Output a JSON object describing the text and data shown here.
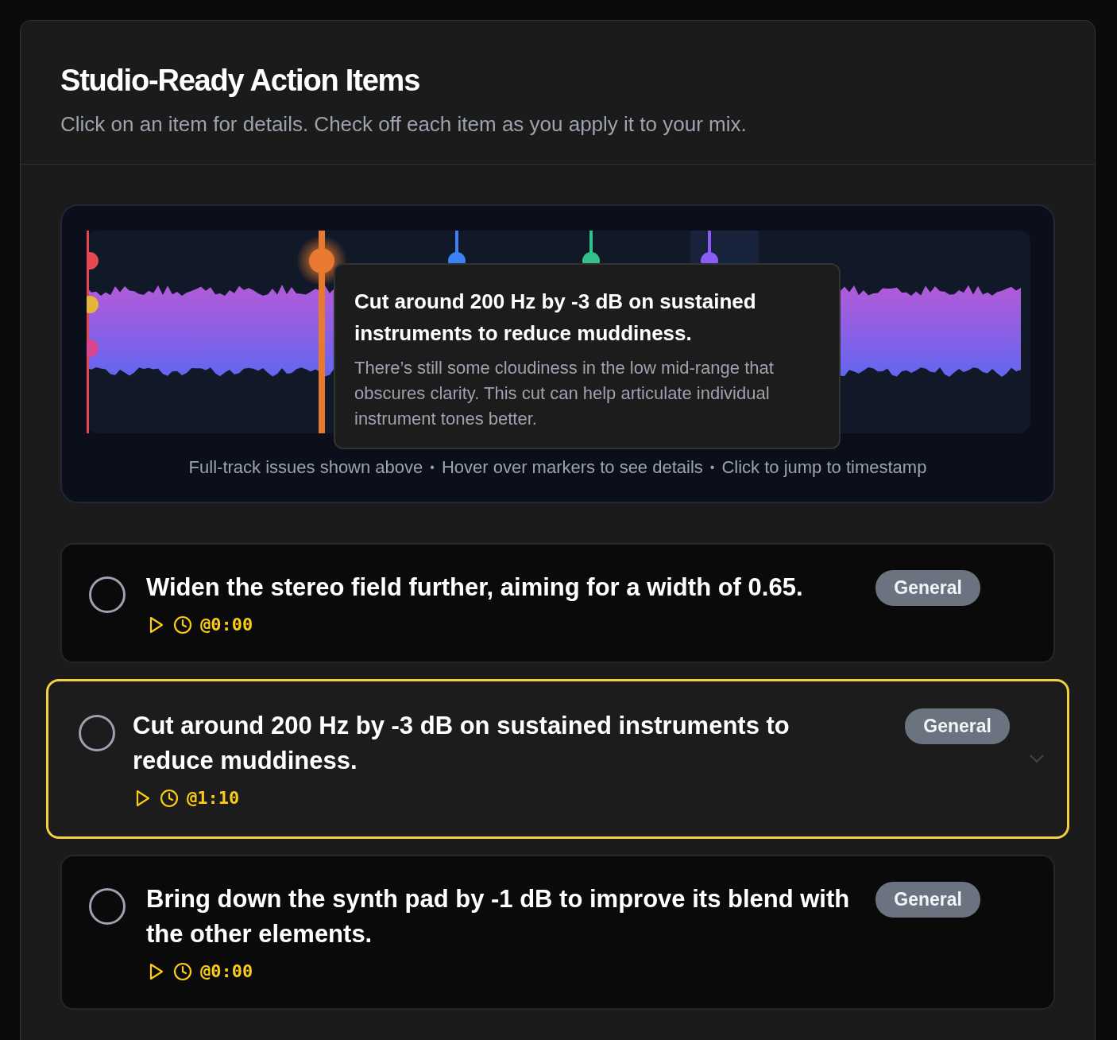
{
  "header": {
    "title": "Studio-Ready Action Items",
    "subtitle": "Click on an item for details. Check off each item as you apply it to your mix."
  },
  "timeline": {
    "edge_markers": [
      {
        "color": "#e5484d"
      },
      {
        "color": "#e5b53a"
      },
      {
        "color": "#d9468f"
      }
    ],
    "markers": [
      {
        "color": "#e8792f",
        "selected": true
      },
      {
        "color": "#3b82f6",
        "selected": false
      },
      {
        "color": "#34c08a",
        "selected": false
      },
      {
        "color": "#8b5cf6",
        "selected": false
      }
    ],
    "tooltip": {
      "title": "Cut around 200 Hz by -3 dB on sustained instruments to reduce muddiness.",
      "body": "There’s still some cloudiness in the low mid-range that obscures clarity. This cut can help articulate individual instrument tones better."
    },
    "caption": [
      "Full-track issues shown above",
      "Hover over markers to see details",
      "Click to jump to timestamp"
    ],
    "separator": "•"
  },
  "items": [
    {
      "title": "Widen the stereo field further, aiming for a width of 0.65.",
      "tag": "General",
      "timestamp": "@0:00",
      "checked": false,
      "selected": false
    },
    {
      "title": "Cut around 200 Hz by -3 dB on sustained instruments to reduce muddiness.",
      "tag": "General",
      "timestamp": "@1:10",
      "checked": false,
      "selected": true
    },
    {
      "title": "Bring down the synth pad by -1 dB to improve its blend with the other elements.",
      "tag": "General",
      "timestamp": "@0:00",
      "checked": false,
      "selected": false
    }
  ]
}
